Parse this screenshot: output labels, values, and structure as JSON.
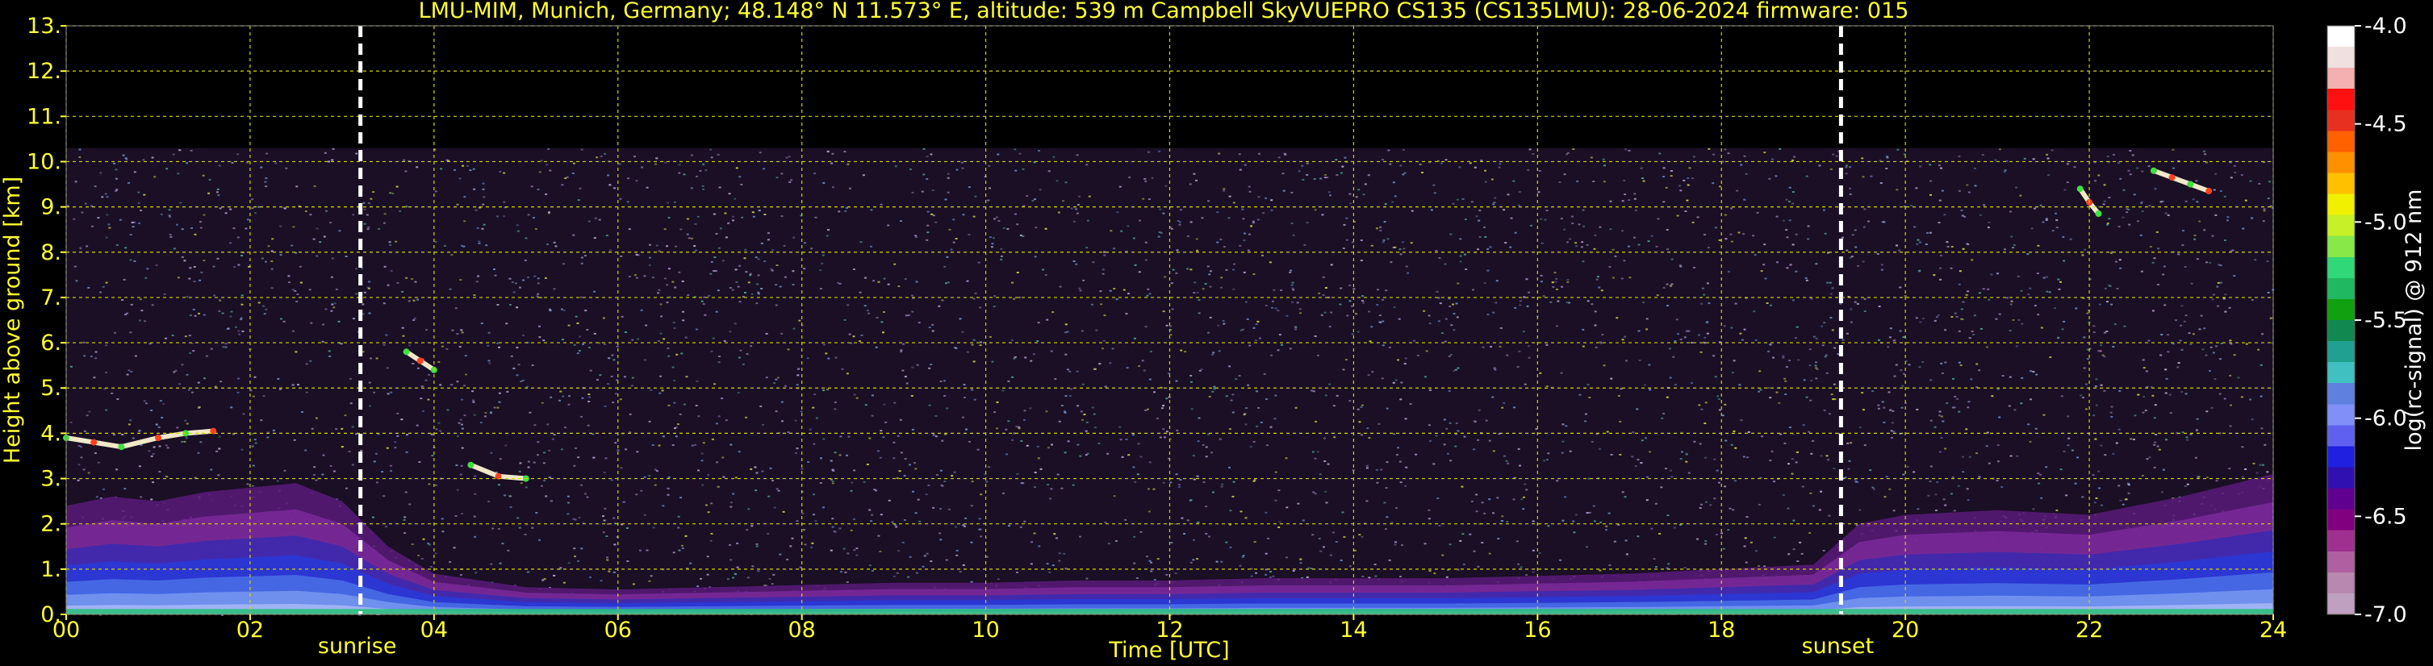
{
  "chart_data": {
    "type": "heatmap",
    "title": "LMU-MIM, Munich, Germany; 48.148° N 11.573° E, altitude: 539 m    Campbell SkyVUEPRO CS135 (CS135LMU): 28-06-2024    firmware: 015",
    "xlabel": "Time [UTC]",
    "ylabel": "Height above ground [km]",
    "xlim": [
      0,
      24
    ],
    "ylim": [
      0,
      13
    ],
    "x_ticks": [
      0,
      2,
      4,
      6,
      8,
      10,
      12,
      14,
      16,
      18,
      20,
      22,
      24
    ],
    "x_tick_labels": [
      "00",
      "02",
      "04",
      "06",
      "08",
      "10",
      "12",
      "14",
      "16",
      "18",
      "20",
      "22",
      "24"
    ],
    "y_ticks": [
      0,
      1,
      2,
      3,
      4,
      5,
      6,
      7,
      8,
      9,
      10,
      11,
      12,
      13
    ],
    "y_tick_labels": [
      "0.",
      "1.",
      "2.",
      "3.",
      "4.",
      "5.",
      "6.",
      "7.",
      "8.",
      "9.",
      "10.",
      "11.",
      "12.",
      "13."
    ],
    "grid": true,
    "colors": {
      "text": "#ffff33",
      "grid": "#d4d400",
      "background": "#000000",
      "marker_line": "#ffffff"
    },
    "markers": [
      {
        "label": "sunrise",
        "x": 3.2
      },
      {
        "label": "sunset",
        "x": 19.3
      }
    ],
    "colorbar": {
      "label": "log(rc-signal) @ 912 nm",
      "range": [
        -7.0,
        -4.0
      ],
      "ticks": [
        -4.0,
        -4.5,
        -5.0,
        -5.5,
        -6.0,
        -6.5,
        -7.0
      ],
      "tick_labels": [
        "-4.0",
        "-4.5",
        "-5.0",
        "-5.5",
        "-6.0",
        "-6.5",
        "-7.0"
      ],
      "colors": [
        "#ffffff",
        "#f0e0e0",
        "#f4b0b0",
        "#ff1010",
        "#e83020",
        "#ff6000",
        "#ff9000",
        "#ffc000",
        "#f0f000",
        "#c8f028",
        "#88e848",
        "#30d878",
        "#20b860",
        "#10a010",
        "#108850",
        "#20a090",
        "#40c0c0",
        "#6080e0",
        "#8090f8",
        "#6060f0",
        "#2020e0",
        "#3010b0",
        "#600090",
        "#800080",
        "#a03090",
        "#b060a0",
        "#b888b0",
        "#c0a0c0"
      ]
    },
    "noise_top_km": 10.3,
    "series": [
      {
        "name": "",
        "x": [
          0.0,
          0.5,
          1.0,
          1.5,
          2.0,
          2.5,
          3.0,
          3.5,
          4.0,
          5.0,
          6.0,
          7.0,
          8.0,
          9.0,
          10.0,
          11.0,
          12.0,
          13.0,
          14.0,
          15.0,
          16.0,
          17.0,
          18.0,
          19.0,
          19.5,
          20.0,
          21.0,
          22.0,
          23.0,
          24.0
        ],
        "y": [
          2.4,
          2.6,
          2.5,
          2.7,
          2.8,
          2.9,
          2.5,
          1.5,
          0.9,
          0.6,
          0.55,
          0.6,
          0.65,
          0.7,
          0.7,
          0.75,
          0.75,
          0.8,
          0.8,
          0.8,
          0.85,
          0.9,
          1.0,
          1.1,
          2.0,
          2.2,
          2.3,
          2.2,
          2.6,
          3.1
        ]
      },
      {
        "name": "",
        "x": [
          0.0,
          0.3,
          0.6,
          1.0,
          1.3,
          1.6
        ],
        "y": [
          3.9,
          3.8,
          3.7,
          3.9,
          4.0,
          4.05
        ]
      },
      {
        "name": "",
        "x": [
          3.7,
          3.85,
          4.0
        ],
        "y": [
          5.8,
          5.6,
          5.4
        ]
      },
      {
        "name": "",
        "x": [
          4.4,
          4.7,
          5.0
        ],
        "y": [
          3.3,
          3.05,
          3.0
        ]
      },
      {
        "name": "",
        "x": [
          21.9,
          22.0,
          22.1
        ],
        "y": [
          9.4,
          9.1,
          8.85
        ]
      },
      {
        "name": "",
        "x": [
          22.7,
          22.9,
          23.1,
          23.3
        ],
        "y": [
          9.8,
          9.65,
          9.5,
          9.35
        ]
      }
    ]
  }
}
